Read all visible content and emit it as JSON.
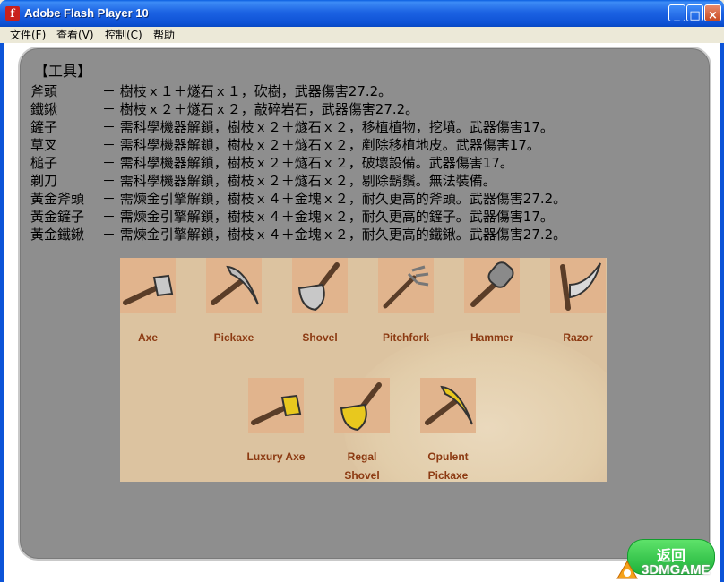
{
  "window": {
    "title": "Adobe Flash Player 10",
    "icon_glyph": "f",
    "minimize_glyph": "_",
    "maximize_glyph": "□",
    "close_glyph": "×"
  },
  "menu": {
    "items": [
      "文件(F)",
      "查看(V)",
      "控制(C)",
      "帮助"
    ]
  },
  "content": {
    "heading": "【工具】",
    "tools": [
      {
        "name": "斧頭",
        "desc": "－ 樹枝ｘ１＋燧石ｘ１，砍樹，武器傷害27.2。"
      },
      {
        "name": "鐵鍬",
        "desc": "－ 樹枝ｘ２＋燧石ｘ２，敲碎岩石，武器傷害27.2。"
      },
      {
        "name": "鏟子",
        "desc": "－ 需科學機器解鎖，樹枝ｘ２＋燧石ｘ２，移植植物，挖墳。武器傷害17。"
      },
      {
        "name": "草叉",
        "desc": "－ 需科學機器解鎖，樹枝ｘ２＋燧石ｘ２，剷除移植地皮。武器傷害17。"
      },
      {
        "name": "槌子",
        "desc": "－ 需科學機器解鎖，樹枝ｘ２＋燧石ｘ２，破壞設備。武器傷害17。"
      },
      {
        "name": "剃刀",
        "desc": "－ 需科學機器解鎖，樹枝ｘ２＋燧石ｘ２，剔除鬍鬚。無法裝備。"
      },
      {
        "name": "黃金斧頭",
        "desc": "－ 需煉金引擎解鎖，樹枝ｘ４＋金塊ｘ２，耐久更高的斧頭。武器傷害27.2。"
      },
      {
        "name": "黃金鏟子",
        "desc": "－ 需煉金引擎解鎖，樹枝ｘ４＋金塊ｘ２，耐久更高的鏟子。武器傷害17。"
      },
      {
        "name": "黃金鐵鍬",
        "desc": "－ 需煉金引擎解鎖，樹枝ｘ４＋金塊ｘ２，耐久更高的鐵鍬。武器傷害27.2。"
      }
    ],
    "image_labels": [
      {
        "line1": "Axe",
        "line2": ""
      },
      {
        "line1": "Pickaxe",
        "line2": ""
      },
      {
        "line1": "Shovel",
        "line2": ""
      },
      {
        "line1": "Pitchfork",
        "line2": ""
      },
      {
        "line1": "Hammer",
        "line2": ""
      },
      {
        "line1": "Razor",
        "line2": ""
      },
      {
        "line1": "Luxury Axe",
        "line2": ""
      },
      {
        "line1": "Regal",
        "line2": "Shovel"
      },
      {
        "line1": "Opulent",
        "line2": "Pickaxe"
      }
    ],
    "icons": [
      "axe-icon",
      "pickaxe-icon",
      "shovel-icon",
      "pitchfork-icon",
      "hammer-icon",
      "razor-icon",
      "luxury-axe-icon",
      "regal-shovel-icon",
      "opulent-pickaxe-icon"
    ]
  },
  "return_button": {
    "label": "返回"
  },
  "watermark": {
    "text": "3DMGAME"
  },
  "colors": {
    "panel": "#8e8e8e",
    "label": "#8c3a12",
    "gold": "#e8c81e",
    "titlebar": "#0e52d6"
  }
}
